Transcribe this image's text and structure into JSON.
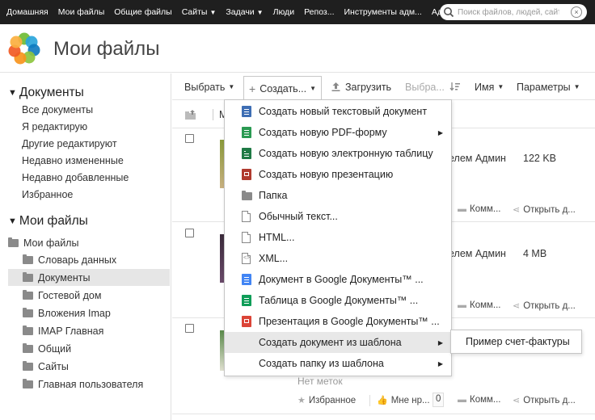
{
  "nav": {
    "items": [
      {
        "label": "Домашняя",
        "caret": false
      },
      {
        "label": "Мои файлы",
        "caret": false
      },
      {
        "label": "Общие файлы",
        "caret": false
      },
      {
        "label": "Сайты",
        "caret": true
      },
      {
        "label": "Задачи",
        "caret": true
      },
      {
        "label": "Люди",
        "caret": false
      },
      {
        "label": "Репоз...",
        "caret": false
      },
      {
        "label": "Инструменты адм...",
        "caret": false
      },
      {
        "label": "Админ",
        "caret": true
      }
    ],
    "search_placeholder": "Поиск файлов, людей, сайтов"
  },
  "header": {
    "title": "Мои файлы"
  },
  "sidebar": {
    "documents_title": "Документы",
    "documents_links": [
      "Все документы",
      "Я редактирую",
      "Другие редактируют",
      "Недавно измененные",
      "Недавно добавленные",
      "Избранное"
    ],
    "myfiles_title": "Мои файлы",
    "tree_root": "Мои файлы",
    "tree": [
      "Словарь данных",
      "Документы",
      "Гостевой дом",
      "Вложения Imap",
      "IMAP Главная",
      "Общий",
      "Сайты",
      "Главная пользователя"
    ],
    "selected_index": 1
  },
  "toolbar": {
    "select": "Выбрать",
    "create": "Создать...",
    "upload": "Загрузить",
    "selected": "Выбра...",
    "sort": "Имя",
    "params": "Параметры"
  },
  "list_header": {
    "column_partial": "М"
  },
  "rows": [
    {
      "modifier": "елем Админ",
      "size": "122 KB",
      "comments": "Комм...",
      "share": "Открыть д..."
    },
    {
      "modifier": "елем Админ",
      "size": "4 MB",
      "comments": "Комм...",
      "share": "Открыть д..."
    },
    {
      "tags": "Нет меток",
      "favorite": "Избранное",
      "like": "Мне нр...",
      "like_count": "0",
      "comments": "Комм...",
      "share": "Открыть д..."
    }
  ],
  "create_menu": [
    {
      "label": "Создать новый текстовый документ",
      "icon": "doc-blue-icon",
      "submenu": false
    },
    {
      "label": "Создать новую PDF-форму",
      "icon": "doc-green-icon",
      "submenu": true
    },
    {
      "label": "Создать новую электронную таблицу",
      "icon": "spreadsheet-green-icon",
      "submenu": false
    },
    {
      "label": "Создать новую презентацию",
      "icon": "presentation-red-icon",
      "submenu": false
    },
    {
      "label": "Папка",
      "icon": "folder-icon",
      "submenu": false
    },
    {
      "label": "Обычный текст...",
      "icon": "text-file-icon",
      "submenu": false
    },
    {
      "label": "HTML...",
      "icon": "html-file-icon",
      "submenu": false
    },
    {
      "label": "XML...",
      "icon": "xml-file-icon",
      "submenu": false
    },
    {
      "label": "Документ в Google Документы™ ...",
      "icon": "google-doc-icon",
      "submenu": false
    },
    {
      "label": "Таблица в Google Документы™ ...",
      "icon": "google-sheet-icon",
      "submenu": false
    },
    {
      "label": "Презентация в Google Документы™ ...",
      "icon": "google-slides-icon",
      "submenu": false
    },
    {
      "label": "Создать документ из шаблона",
      "icon": "",
      "submenu": true
    },
    {
      "label": "Создать папку из шаблона",
      "icon": "",
      "submenu": true
    }
  ],
  "template_submenu": [
    "Пример счет-фактуры"
  ],
  "colors": {
    "topbar": "#1f1f1f",
    "doc_blue": "#3e6eb4",
    "green": "#2a9a52",
    "sheet_green": "#1f7a45",
    "red": "#c0392b",
    "google_blue": "#4285f4",
    "google_green": "#0f9d58",
    "google_red": "#db4437"
  }
}
